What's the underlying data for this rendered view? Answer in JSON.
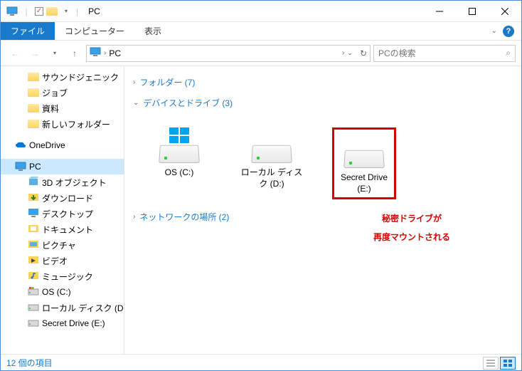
{
  "window": {
    "title": "PC"
  },
  "ribbon": {
    "file": "ファイル",
    "tabs": [
      "コンピューター",
      "表示"
    ]
  },
  "nav": {
    "location_label": "PC",
    "breadcrumb_sep": "›",
    "search_placeholder": "PCの検索"
  },
  "sidebar": {
    "quick": [
      "サウンドジェニック",
      "ジョブ",
      "資料",
      "新しいフォルダー"
    ],
    "onedrive": "OneDrive",
    "pc": "PC",
    "pc_children": [
      {
        "label": "3D オブジェクト",
        "icon": "3d"
      },
      {
        "label": "ダウンロード",
        "icon": "down"
      },
      {
        "label": "デスクトップ",
        "icon": "desktop"
      },
      {
        "label": "ドキュメント",
        "icon": "doc"
      },
      {
        "label": "ピクチャ",
        "icon": "pic"
      },
      {
        "label": "ビデオ",
        "icon": "video"
      },
      {
        "label": "ミュージック",
        "icon": "music"
      },
      {
        "label": "OS (C:)",
        "icon": "drive-win"
      },
      {
        "label": "ローカル ディスク (D:)",
        "icon": "drive"
      },
      {
        "label": "Secret Drive (E:)",
        "icon": "drive"
      }
    ]
  },
  "main": {
    "groups": {
      "folders": "フォルダー (7)",
      "drives": "デバイスとドライブ (3)",
      "network": "ネットワークの場所 (2)"
    },
    "drives": [
      {
        "label": "OS (C:)",
        "windows": true
      },
      {
        "label": "ローカル ディスク (D:)",
        "windows": false
      },
      {
        "label": "Secret Drive (E:)",
        "windows": false,
        "highlight": true
      }
    ]
  },
  "annotation": {
    "line1": "秘密ドライブが",
    "line2": "再度マウントされる"
  },
  "statusbar": {
    "count": "12 個の項目"
  }
}
